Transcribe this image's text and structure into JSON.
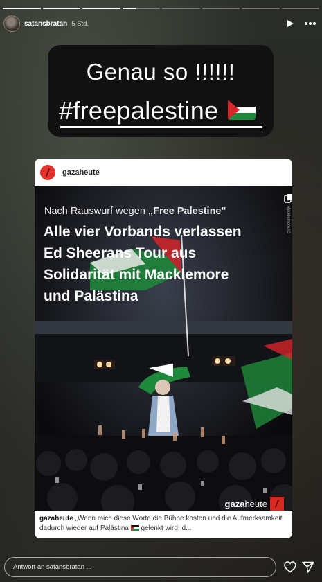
{
  "story": {
    "progress": [
      1,
      1,
      1,
      0.35,
      0,
      0,
      0,
      0
    ],
    "username": "satansbratan",
    "time": "5 Std."
  },
  "sticker": {
    "line1": "Genau so !!!!!!",
    "line2": "#freepalestine"
  },
  "post": {
    "account": "gazaheute",
    "kicker_prefix": "Nach Rauswurf wegen ",
    "kicker_quote": "„Free Palestine\"",
    "headline_lines": [
      "Alle vier Vorbands verlassen",
      "Ed Sheerans Tour aus",
      "Solidarität mit Macklemore",
      "und Palästina"
    ],
    "credit": "© Macklemore/IG",
    "brand_bold": "gaza",
    "brand_rest": "heute",
    "caption_user": "gazaheute",
    "caption_text_1": " „Wenn mich diese Worte die Bühne kosten und die Aufmerksamkeit dadurch wieder auf Palästina ",
    "caption_text_2": " gelenkt wird, d..."
  },
  "reply": {
    "placeholder": "Antwort an satansbratan ..."
  },
  "icons": [
    "play-icon",
    "more-icon",
    "heart-icon",
    "send-icon",
    "page-icon"
  ],
  "colors": {
    "accent_red": "#e3332c",
    "flag_green": "#1f8a3b",
    "flag_red": "#d4252a"
  }
}
